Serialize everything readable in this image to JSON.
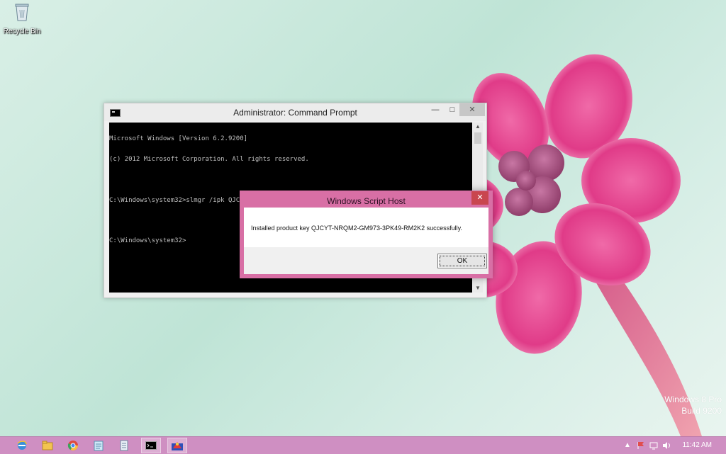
{
  "desktop": {
    "icons": [
      {
        "label": "Recycle Bin",
        "icon": "recycle-bin-icon"
      }
    ],
    "watermark": {
      "line1": "Windows 8 Pro",
      "line2": "Build 9200"
    }
  },
  "cmd_window": {
    "title": "Administrator: Command Prompt",
    "min_glyph": "—",
    "max_glyph": "□",
    "close_glyph": "✕",
    "lines": [
      "Microsoft Windows [Version 6.2.9200]",
      "(c) 2012 Microsoft Corporation. All rights reserved.",
      "",
      "C:\\Windows\\system32>slmgr /ipk QJCYT-NRQM2-GM973-3PK49-RM2K2",
      "",
      "C:\\Windows\\system32>"
    ],
    "scroll_up": "▲",
    "scroll_down": "▼"
  },
  "dialog": {
    "title": "Windows Script Host",
    "close_glyph": "✕",
    "message": "Installed product key QJCYT-NRQM2-GM973-3PK49-RM2K2 successfully.",
    "ok_label": "OK"
  },
  "taskbar": {
    "items": [
      {
        "icon": "internet-explorer-icon",
        "active": false
      },
      {
        "icon": "file-explorer-icon",
        "active": false
      },
      {
        "icon": "chrome-icon",
        "active": false
      },
      {
        "icon": "notepad-icon",
        "active": false
      },
      {
        "icon": "document-icon",
        "active": false
      },
      {
        "icon": "command-prompt-icon",
        "active": true
      },
      {
        "icon": "script-host-icon",
        "active": true
      }
    ],
    "tray": {
      "chevron": "▲",
      "time": "11:42 AM"
    }
  },
  "colors": {
    "taskbar": "#cf8fc2",
    "dialog_frame": "#d86fa5",
    "close_red": "#c9464f"
  }
}
